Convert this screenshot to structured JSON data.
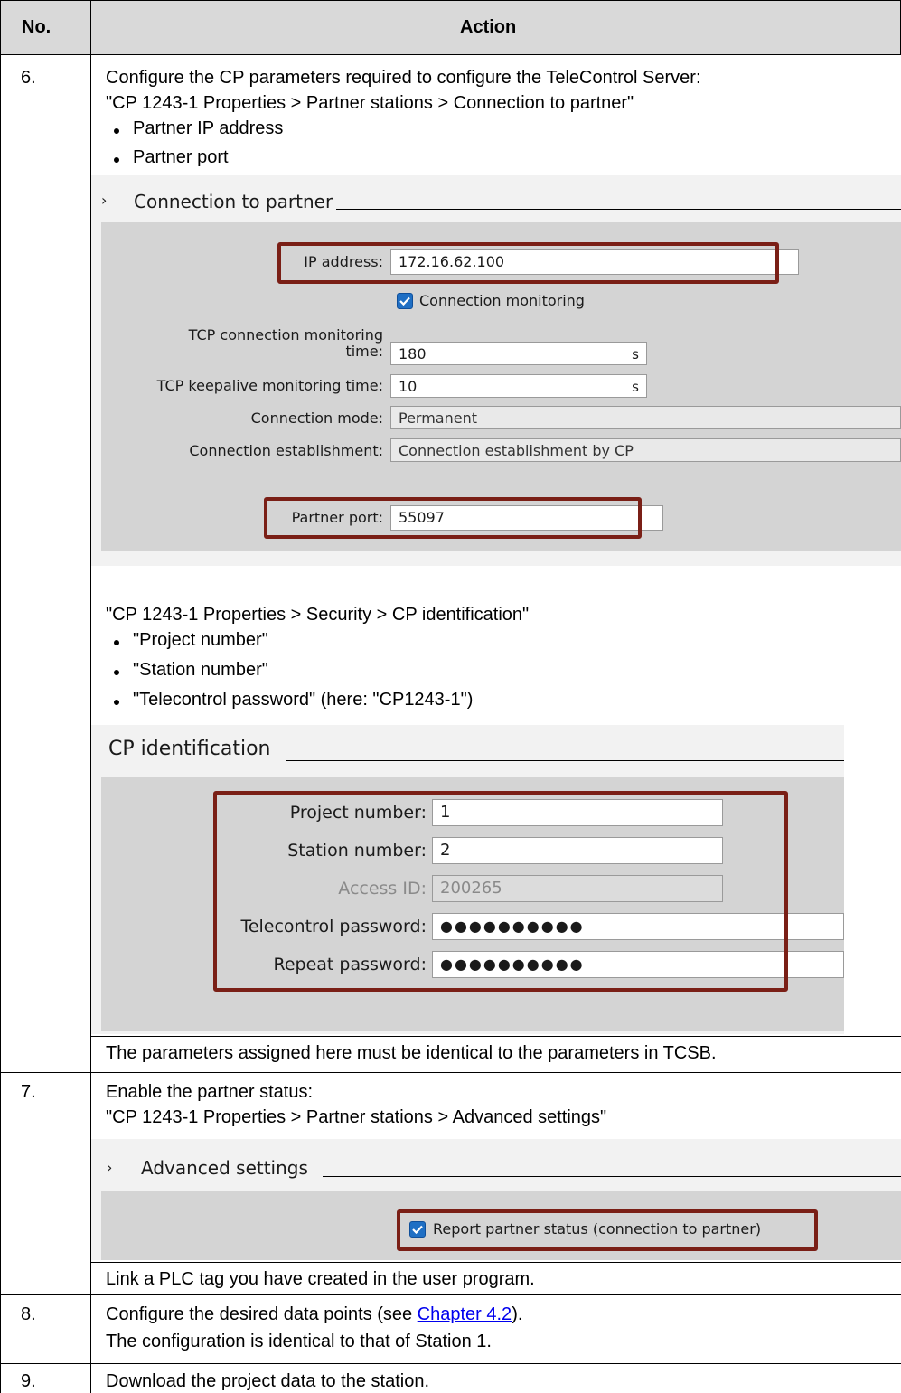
{
  "table": {
    "header": {
      "no": "No.",
      "action": "Action"
    },
    "rows": [
      {
        "no": "6.",
        "intro": "Configure the CP parameters required to configure the TeleControl Server:",
        "path1": "\"CP 1243-1 Properties > Partner stations > Connection to partner\"",
        "bullets1": [
          "Partner IP address",
          "Partner port"
        ],
        "path2": "\"CP 1243-1 Properties > Security > CP identification\"",
        "bullets2": [
          "\"Project number\"",
          "\"Station number\"",
          "\"Telecontrol password\" (here: \"CP1243-1\")"
        ],
        "note": "The parameters assigned here must be identical to the parameters in TCSB."
      },
      {
        "no": "7.",
        "intro": "Enable the partner status:",
        "path": "\"CP 1243-1 Properties > Partner stations > Advanced settings\"",
        "note": "Link a PLC tag you have created in the user program."
      },
      {
        "no": "8.",
        "line1_pre": "Configure the desired data points (see ",
        "line1_link": "Chapter 4.2",
        "line1_post": ").",
        "line2": "The configuration is identical to that of Station 1."
      },
      {
        "no": "9.",
        "text": "Download the project data to the station."
      }
    ]
  },
  "connection_panel": {
    "title": "Connection to partner",
    "ip_label": "IP address:",
    "ip_value": "172.16.62.100",
    "monitoring_checkbox": "Connection monitoring",
    "tcp_time_label_1": "TCP connection monitoring",
    "tcp_time_label_2": "time:",
    "tcp_time_value": "180",
    "tcp_time_unit": "s",
    "keepalive_label": "TCP keepalive monitoring time:",
    "keepalive_value": "10",
    "keepalive_unit": "s",
    "mode_label": "Connection mode:",
    "mode_value": "Permanent",
    "establish_label": "Connection establishment:",
    "establish_value": "Connection establishment by CP",
    "port_label": "Partner port:",
    "port_value": "55097"
  },
  "identification_panel": {
    "title": "CP identification",
    "project_label": "Project number:",
    "project_value": "1",
    "station_label": "Station number:",
    "station_value": "2",
    "access_label": "Access ID:",
    "access_value": "200265",
    "password_label": "Telecontrol password:",
    "password_value": "●●●●●●●●●●",
    "repeat_label": "Repeat password:",
    "repeat_value": "●●●●●●●●●●"
  },
  "advanced_panel": {
    "title": "Advanced settings",
    "checkbox_label": "Report partner status (connection to partner)"
  },
  "colors": {
    "highlight_box": "#7a1f16",
    "checkbox": "#1f6fc4",
    "header_bg": "#d9d9d9"
  }
}
